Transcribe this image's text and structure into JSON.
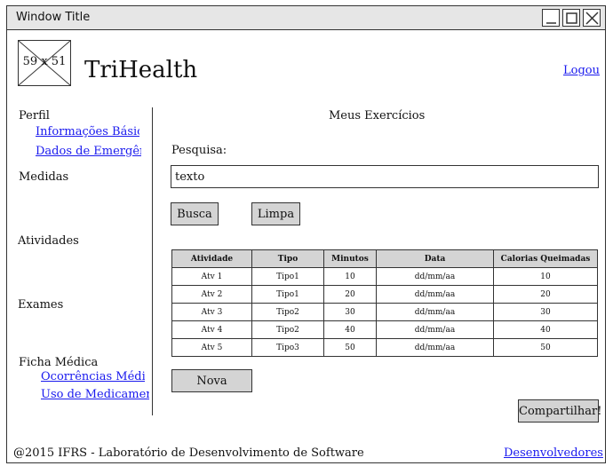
{
  "window": {
    "title": "Window Title"
  },
  "header": {
    "logo_placeholder": "59 x 51",
    "brand": "TriHealth",
    "logout": "Logou"
  },
  "sidebar": {
    "perfil": {
      "label": "Perfil",
      "items": [
        "Informações Básicas",
        "Dados de Emergência"
      ]
    },
    "medidas": "Medidas",
    "atividades": "Atividades",
    "exames": "Exames",
    "ficha": {
      "label": "Ficha Médica",
      "items": [
        "Ocorrências Médicas",
        "Uso de Medicamentos"
      ]
    }
  },
  "main": {
    "heading": "Meus Exercícios",
    "search_label": "Pesquisa:",
    "search_value": "texto",
    "busca": "Busca",
    "limpa": "Limpa",
    "table": {
      "columns": [
        "Atividade",
        "Tipo",
        "Minutos",
        "Data",
        "Calorias Queimadas"
      ],
      "rows": [
        [
          "Atv 1",
          "Tipo1",
          "10",
          "dd/mm/aa",
          "10"
        ],
        [
          "Atv 2",
          "Tipo1",
          "20",
          "dd/mm/aa",
          "20"
        ],
        [
          "Atv 3",
          "Tipo2",
          "30",
          "dd/mm/aa",
          "30"
        ],
        [
          "Atv 4",
          "Tipo2",
          "40",
          "dd/mm/aa",
          "40"
        ],
        [
          "Atv 5",
          "Tipo3",
          "50",
          "dd/mm/aa",
          "50"
        ]
      ]
    },
    "nova": "Nova",
    "compartilhar": "Compartilhar!"
  },
  "footer": {
    "copyright": "@2015 IFRS - Laboratório de Desenvolvimento de Software",
    "devs": "Desenvolvedores"
  }
}
